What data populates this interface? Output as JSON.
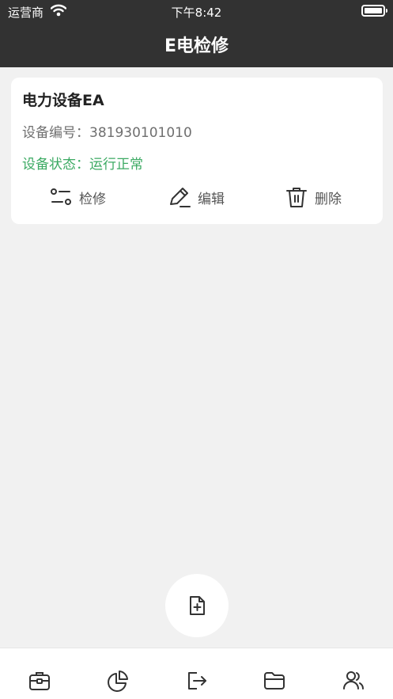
{
  "status_bar": {
    "carrier": "运营商",
    "time": "下午8:42"
  },
  "nav": {
    "title": "E电检修"
  },
  "device": {
    "name": "电力设备EA",
    "code_label": "设备编号：381930101010",
    "status_label": "设备状态：运行正常"
  },
  "actions": {
    "repair": "检修",
    "edit": "编辑",
    "delete": "删除"
  },
  "colors": {
    "header_bg": "#323232",
    "status_green": "#3caa63",
    "page_bg": "#f1f1f1"
  },
  "tabs": [
    "briefcase-icon",
    "pie-chart-icon",
    "logout-icon",
    "folder-icon",
    "users-icon"
  ]
}
